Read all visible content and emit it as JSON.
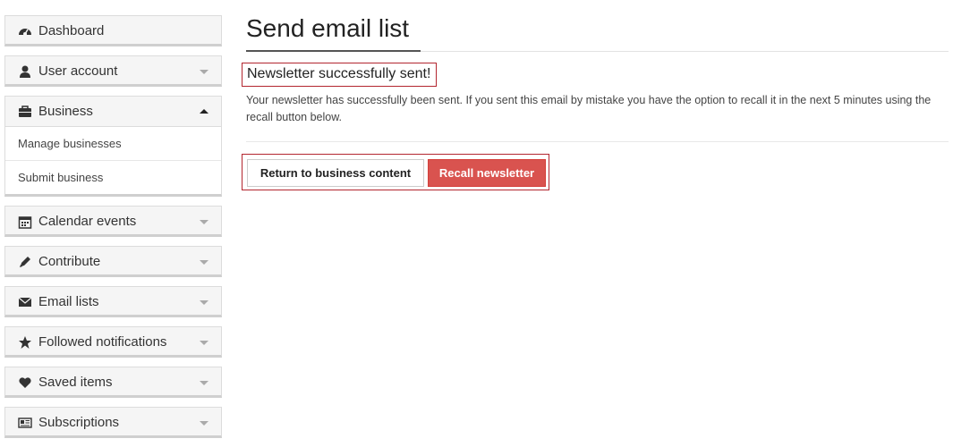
{
  "sidebar": {
    "items": [
      {
        "label": "Dashboard",
        "icon": "dashboard-icon"
      },
      {
        "label": "User account",
        "icon": "user-icon"
      },
      {
        "label": "Business",
        "icon": "briefcase-icon",
        "expanded": true,
        "children": [
          {
            "label": "Manage businesses"
          },
          {
            "label": "Submit business"
          }
        ]
      },
      {
        "label": "Calendar events",
        "icon": "calendar-icon"
      },
      {
        "label": "Contribute",
        "icon": "pencil-icon"
      },
      {
        "label": "Email lists",
        "icon": "envelope-icon"
      },
      {
        "label": "Followed notifications",
        "icon": "star-icon"
      },
      {
        "label": "Saved items",
        "icon": "heart-icon"
      },
      {
        "label": "Subscriptions",
        "icon": "newspaper-icon"
      }
    ]
  },
  "main": {
    "title": "Send email list",
    "alert": {
      "heading": "Newsletter successfully sent!",
      "body": "Your newsletter has successfully been sent. If you sent this email by mistake you have the option to recall it in the next 5 minutes using the recall button below."
    },
    "buttons": {
      "return_label": "Return to business content",
      "recall_label": "Recall newsletter"
    }
  },
  "colors": {
    "accent_red": "#d9534f",
    "highlight_border": "#b3262f",
    "sidebar_bg": "#f5f5f5"
  }
}
